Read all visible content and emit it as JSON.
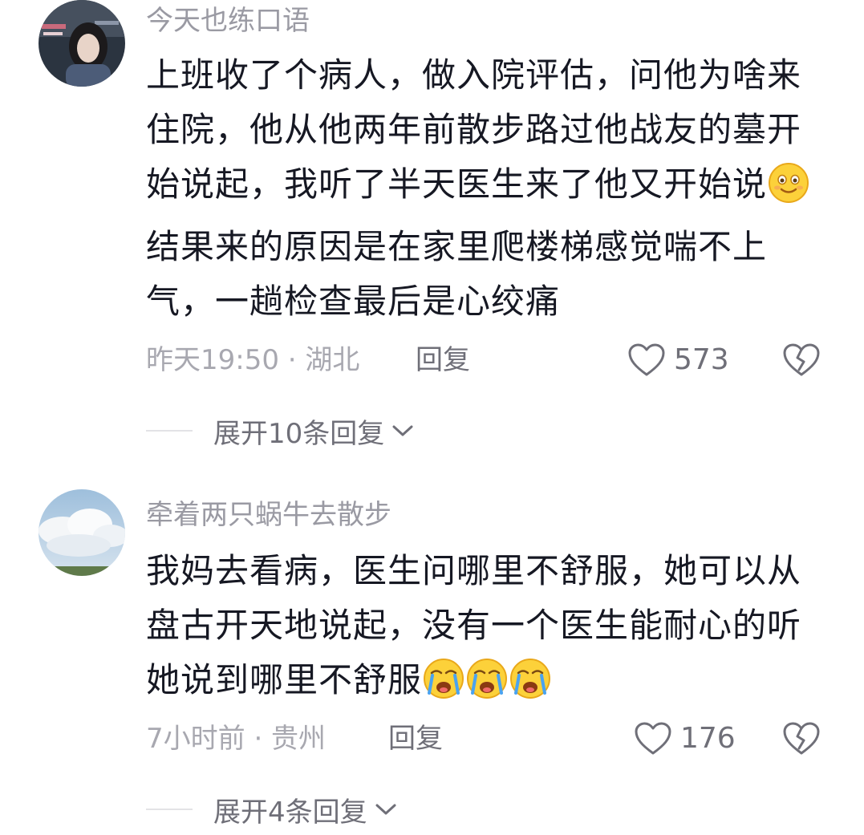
{
  "comments": [
    {
      "username": "今天也练口语",
      "text_parts": [
        "上班收了个病人，做入院评估，问他为啥来住院，他从他两年前散步路过他战友的墓开始说起，我听了半天医生来了他又开始说",
        "结果来的原因是在家里爬楼梯感觉喘不上气，一趟检查最后是心绞痛"
      ],
      "emoji": "smile-emoji",
      "time_location": "昨天19:50 · 湖北",
      "reply_label": "回复",
      "likes": "573",
      "expand_label": "展开10条回复"
    },
    {
      "username": "牵着两只蜗牛去散步",
      "text_parts": [
        "我妈去看病，医生问哪里不舒服，她可以从盘古开天地说起，没有一个医生能耐心的听她说到哪里不舒服"
      ],
      "emoji": "crying-emoji",
      "emoji_count": 3,
      "time_location": "7小时前 · 贵州",
      "reply_label": "回复",
      "likes": "176",
      "expand_label": "展开4条回复"
    }
  ],
  "colors": {
    "username": "#9a9aa3",
    "body": "#161823",
    "meta": "#a8a8b0",
    "action": "#6f6f78"
  }
}
